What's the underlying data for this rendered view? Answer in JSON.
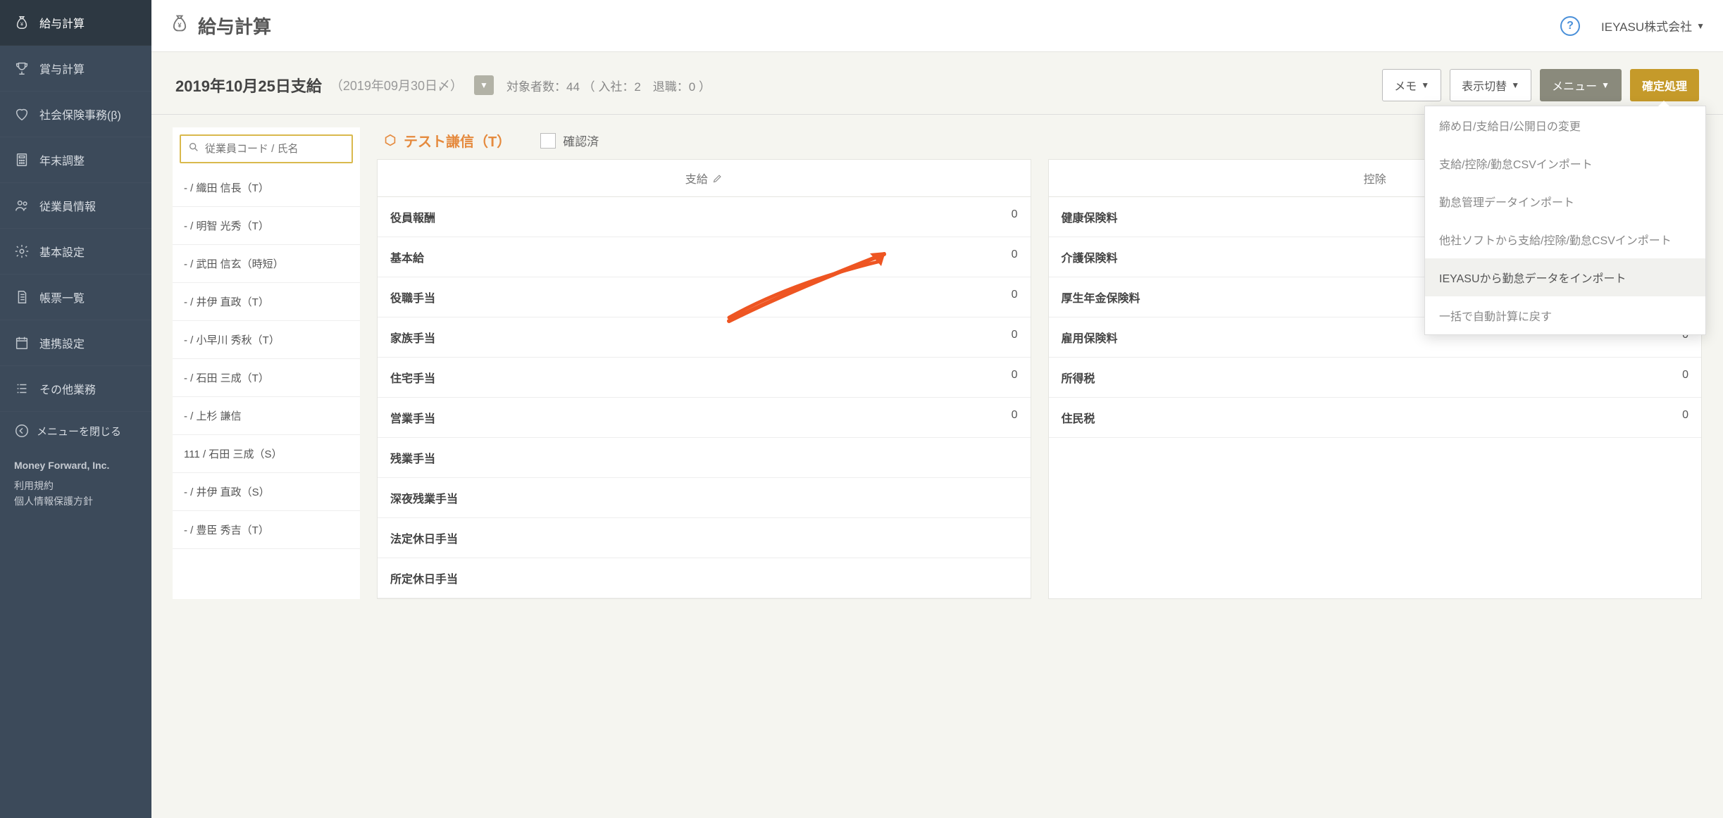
{
  "sidebar": {
    "items": [
      {
        "label": "給与計算",
        "icon": "money-bag",
        "active": true
      },
      {
        "label": "賞与計算",
        "icon": "trophy"
      },
      {
        "label": "社会保険事務(β)",
        "icon": "heart"
      },
      {
        "label": "年末調整",
        "icon": "calculator"
      },
      {
        "label": "従業員情報",
        "icon": "people"
      },
      {
        "label": "基本設定",
        "icon": "gear"
      },
      {
        "label": "帳票一覧",
        "icon": "document"
      },
      {
        "label": "連携設定",
        "icon": "calendar"
      },
      {
        "label": "その他業務",
        "icon": "list"
      }
    ],
    "collapse_label": "メニューを閉じる",
    "footer_company": "Money Forward, Inc.",
    "footer_links": [
      "利用規約",
      "個人情報保護方針"
    ]
  },
  "header": {
    "title": "給与計算",
    "help": "?",
    "org": "IEYASU株式会社"
  },
  "subheader": {
    "paydate": "2019年10月25日支給",
    "cutoff": "（2019年09月30日〆）",
    "counts": "対象者数：44 （ 入社：2　退職：0 ）",
    "memo_btn": "メモ",
    "display_btn": "表示切替",
    "menu_btn": "メニュー",
    "confirm_btn": "確定処理"
  },
  "search": {
    "placeholder": "従業員コード / 氏名"
  },
  "employees": [
    "- / 織田 信長（T）",
    "- / 明智 光秀（T）",
    "- / 武田 信玄（時短）",
    "- / 井伊 直政（T）",
    "- / 小早川 秀秋（T）",
    "- / 石田 三成（T）",
    "- / 上杉 謙信",
    "111 / 石田 三成（S）",
    "- / 井伊 直政（S）",
    "- / 豊臣 秀吉（T）"
  ],
  "detail": {
    "name": "テスト謙信（T）",
    "confirmed_label": "確認済",
    "pay_header": "支給",
    "ded_header": "控除",
    "pay_rows": [
      {
        "k": "役員報酬",
        "v": "0"
      },
      {
        "k": "基本給",
        "v": "0"
      },
      {
        "k": "役職手当",
        "v": "0"
      },
      {
        "k": "家族手当",
        "v": "0"
      },
      {
        "k": "住宅手当",
        "v": "0"
      },
      {
        "k": "営業手当",
        "v": "0"
      },
      {
        "k": "残業手当",
        "v": ""
      },
      {
        "k": "深夜残業手当",
        "v": ""
      },
      {
        "k": "法定休日手当",
        "v": ""
      },
      {
        "k": "所定休日手当",
        "v": ""
      }
    ],
    "ded_rows": [
      {
        "k": "健康保険料",
        "v": ""
      },
      {
        "k": "介護保険料",
        "v": ""
      },
      {
        "k": "厚生年金保険料",
        "v": ""
      },
      {
        "k": "雇用保険料",
        "v": "0"
      },
      {
        "k": "所得税",
        "v": "0"
      },
      {
        "k": "住民税",
        "v": "0"
      }
    ]
  },
  "menu_dropdown": {
    "items": [
      "締め日/支給日/公開日の変更",
      "支給/控除/勤怠CSVインポート",
      "勤怠管理データインポート",
      "他社ソフトから支給/控除/勤怠CSVインポート",
      "IEYASUから勤怠データをインポート",
      "一括で自動計算に戻す"
    ],
    "highlighted_index": 4
  }
}
